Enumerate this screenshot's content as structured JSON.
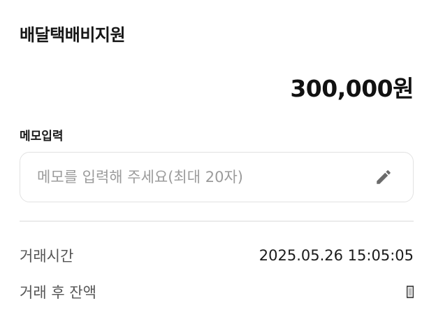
{
  "header": {
    "title": "배달택배비지원"
  },
  "amount": {
    "display": "300,000원"
  },
  "memo": {
    "label": "메모입력",
    "value": "",
    "placeholder": "메모를 입력해 주세요(최대 20자)",
    "icon": "pencil-icon"
  },
  "details": {
    "time_label": "거래시간",
    "time_value": "2025.05.26 15:05:05",
    "balance_label": "거래 후 잔액",
    "balance_icon": "masked-value-icon"
  },
  "colors": {
    "text_primary": "#111111",
    "text_secondary": "#555555",
    "placeholder": "#9b9b9b",
    "border": "#e2e2e2",
    "icon": "#6b6b6b"
  }
}
